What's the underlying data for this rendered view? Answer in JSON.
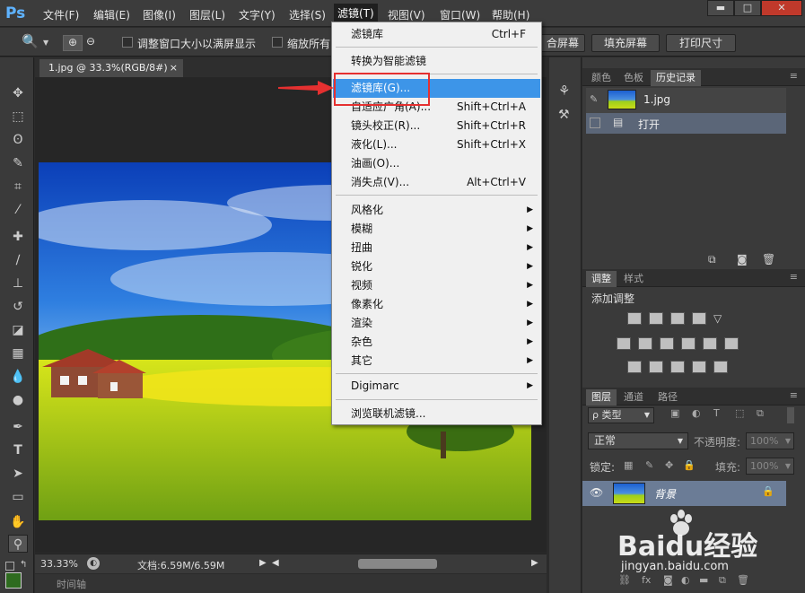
{
  "app": {
    "logo": "Ps"
  },
  "menubar": {
    "items": [
      "文件(F)",
      "编辑(E)",
      "图像(I)",
      "图层(L)",
      "文字(Y)",
      "选择(S)",
      "滤镜(T)",
      "视图(V)",
      "窗口(W)",
      "帮助(H)"
    ],
    "active_index": 6,
    "window_controls": [
      "▬",
      "□",
      "✕"
    ]
  },
  "options": {
    "check1": "调整窗口大小以满屏显示",
    "check2": "缩放所有",
    "btn_fit": "合屏幕",
    "btn_fill": "填充屏幕",
    "btn_print": "打印尺寸"
  },
  "document": {
    "tab": "1.jpg @ 33.3%(RGB/8#)",
    "tab_close": "×",
    "zoom": "33.33%",
    "doc_size": "文档:6.59M/6.59M",
    "timeline": "时间轴"
  },
  "filter_menu": {
    "items": [
      {
        "label": "滤镜库",
        "shortcut": "Ctrl+F"
      },
      {
        "label": "转换为智能滤镜"
      },
      {
        "label": "滤镜库(G)...",
        "highlighted": true
      },
      {
        "label": "自适应广角(A)...",
        "shortcut": "Shift+Ctrl+A"
      },
      {
        "label": "镜头校正(R)...",
        "shortcut": "Shift+Ctrl+R"
      },
      {
        "label": "液化(L)...",
        "shortcut": "Shift+Ctrl+X"
      },
      {
        "label": "油画(O)..."
      },
      {
        "label": "消失点(V)...",
        "shortcut": "Alt+Ctrl+V"
      },
      {
        "label": "风格化",
        "submenu": true
      },
      {
        "label": "模糊",
        "submenu": true
      },
      {
        "label": "扭曲",
        "submenu": true
      },
      {
        "label": "锐化",
        "submenu": true
      },
      {
        "label": "视频",
        "submenu": true
      },
      {
        "label": "像素化",
        "submenu": true
      },
      {
        "label": "渲染",
        "submenu": true
      },
      {
        "label": "杂色",
        "submenu": true
      },
      {
        "label": "其它",
        "submenu": true
      },
      {
        "label": "Digimarc",
        "submenu": true
      },
      {
        "label": "浏览联机滤镜..."
      }
    ]
  },
  "panels": {
    "history_tabs": [
      "颜色",
      "色板",
      "历史记录"
    ],
    "history_snapshot": "1.jpg",
    "history_step": "打开",
    "adjust_tabs": [
      "调整",
      "样式"
    ],
    "adjust_title": "添加调整",
    "layers_tabs": [
      "图层",
      "通道",
      "路径"
    ],
    "layer_filter": "ρ 类型",
    "blend_mode": "正常",
    "opacity_label": "不透明度:",
    "opacity_value": "100%",
    "lock_label": "锁定:",
    "fill_label": "填充:",
    "fill_value": "100%",
    "layer_name": "背景"
  },
  "watermark": {
    "brand": "Baidu经验",
    "url": "jingyan.baidu.com"
  },
  "colors": {
    "highlight": "#3d95e8",
    "annotation": "#e53030",
    "ps_blue": "#5fb3ff"
  }
}
